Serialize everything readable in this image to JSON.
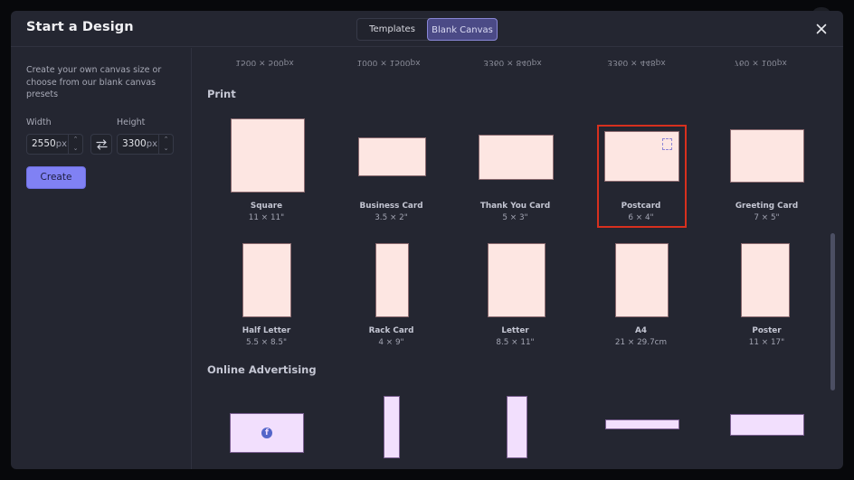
{
  "modal": {
    "title": "Start a Design",
    "tabs": [
      {
        "label": "Templates",
        "active": false
      },
      {
        "label": "Blank Canvas",
        "active": true
      }
    ],
    "close_icon": "close-icon"
  },
  "sidebar": {
    "description": "Create your own canvas size or choose from our blank canvas presets",
    "width_label": "Width",
    "height_label": "Height",
    "width_value": "2550",
    "height_value": "3300",
    "unit": "px",
    "swap_icon": "swap-arrows-icon",
    "create_label": "Create"
  },
  "content": {
    "previous_row_sizes": [
      "1500 × 500px",
      "1000 × 1500px",
      "3360 × 840px",
      "3360 × 448px",
      "760 × 100px"
    ],
    "sections": [
      {
        "title": "Print",
        "presets": [
          {
            "name": "Square",
            "size": "11 × 11\""
          },
          {
            "name": "Business Card",
            "size": "3.5 × 2\""
          },
          {
            "name": "Thank You Card",
            "size": "5 × 3\""
          },
          {
            "name": "Postcard",
            "size": "6 × 4\"",
            "selected": true
          },
          {
            "name": "Greeting Card",
            "size": "7 × 5\""
          },
          {
            "name": "Half Letter",
            "size": "5.5 × 8.5\""
          },
          {
            "name": "Rack Card",
            "size": "4 × 9\""
          },
          {
            "name": "Letter",
            "size": "8.5 × 11\""
          },
          {
            "name": "A4",
            "size": "21 × 29.7cm"
          },
          {
            "name": "Poster",
            "size": "11 × 17\""
          }
        ]
      },
      {
        "title": "Online Advertising",
        "presets": [
          {
            "icon": "facebook-icon"
          },
          {},
          {},
          {},
          {}
        ]
      }
    ]
  },
  "colors": {
    "accent": "#8081f4",
    "selection": "#d7301e",
    "print_thumb": "#fde6e2",
    "ad_thumb": "#f2dffd",
    "background": "#242631"
  }
}
